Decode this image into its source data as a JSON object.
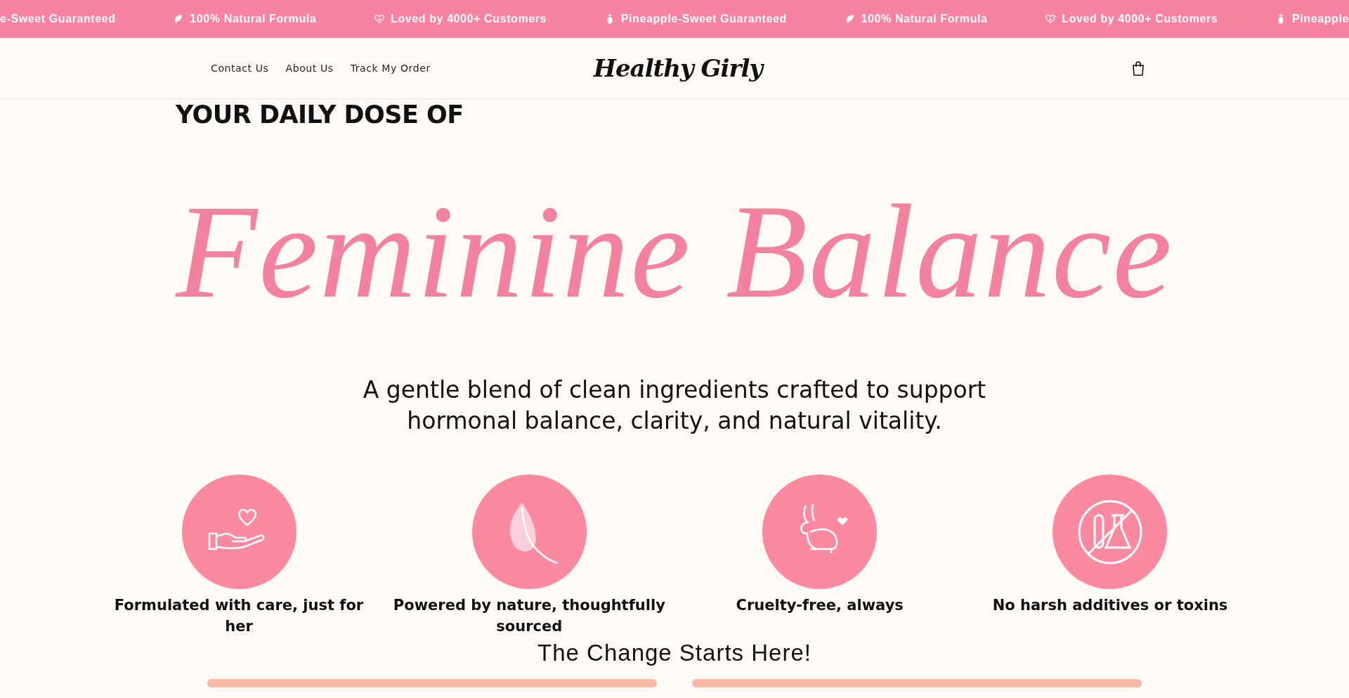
{
  "announcement_bar": [
    {
      "kind": "none",
      "text": "e-Sweet Guaranteed"
    },
    {
      "kind": "leaf",
      "text": "100% Natural Formula"
    },
    {
      "kind": "heart",
      "text": "Loved by 4000+ Customers"
    },
    {
      "kind": "pineapple",
      "text": "Pineapple-Sweet Guaranteed"
    },
    {
      "kind": "leaf",
      "text": "100% Natural Formula"
    },
    {
      "kind": "heart",
      "text": "Loved by 4000+ Customers"
    },
    {
      "kind": "pineapple",
      "text": "Pineapple"
    }
  ],
  "header": {
    "nav": [
      "Contact Us",
      "About Us",
      "Track My Order"
    ],
    "logo": "Healthy Girly"
  },
  "hero": {
    "eyebrow": "YOUR DAILY DOSE OF",
    "headline": "Feminine Balance",
    "subtitle": "A gentle blend of clean ingredients crafted to support hormonal balance, clarity, and natural vitality."
  },
  "features": [
    {
      "kind": "hand-heart",
      "label": "Formulated with care, just for her"
    },
    {
      "kind": "leaf",
      "label": "Powered by nature, thoughtfully sourced"
    },
    {
      "kind": "rabbit",
      "label": "Cruelty-free, always"
    },
    {
      "kind": "no-chemicals",
      "label": "No harsh additives or toxins"
    }
  ],
  "cta_heading": "The Change Starts Here!"
}
